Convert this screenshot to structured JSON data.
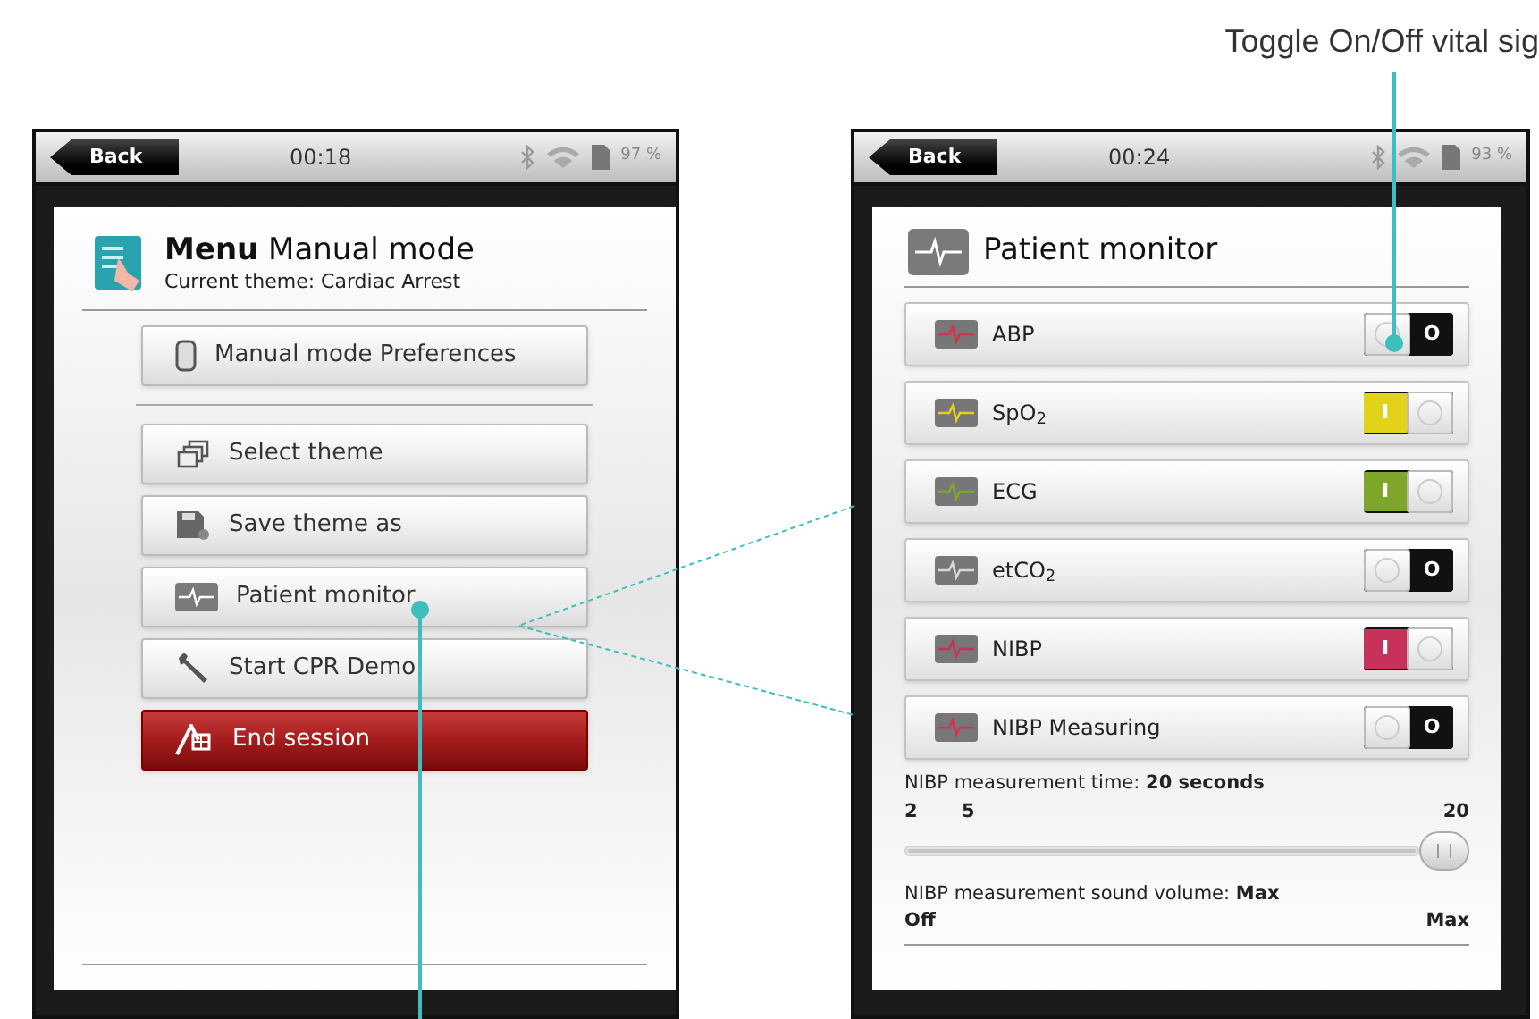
{
  "caption": "Toggle On/Off vital sig",
  "left_screen": {
    "status_bar": {
      "back": "Back",
      "time": "00:18",
      "battery": "97 %"
    },
    "dialog": {
      "title": "**Menu** Manual mode",
      "subtitle": "Current theme: Cardiac Arrest",
      "top_button": {
        "label": "Manual mode Preferences"
      },
      "buttons": [
        {
          "label": "Select theme",
          "kind": "normal"
        },
        {
          "label": "Save theme as",
          "kind": "normal"
        },
        {
          "label": "Patient monitor",
          "kind": "normal"
        },
        {
          "label": "Start CPR Demo",
          "kind": "normal"
        },
        {
          "label": "End session",
          "kind": "danger"
        }
      ]
    }
  },
  "right_screen": {
    "status_bar": {
      "back": "Back",
      "time": "00:24",
      "battery": "93 %"
    },
    "dialog": {
      "title": "Patient monitor",
      "vitals": [
        {
          "name": "ABP",
          "on": false,
          "switch_text": "O",
          "color": "#d9304f"
        },
        {
          "name": "SpO$_{2}$",
          "on": true,
          "switch_text": "I",
          "color": "#e2d21a"
        },
        {
          "name": "ECG",
          "on": true,
          "switch_text": "I",
          "color": "#7ea62a"
        },
        {
          "name": "etCO$_{2}$",
          "on": false,
          "switch_text": "O",
          "color": "#d8d8d8"
        },
        {
          "name": "NIBP",
          "on": true,
          "switch_text": "I",
          "color": "#c8325a"
        },
        {
          "name": "NIBP Measuring",
          "on": false,
          "switch_text": "O",
          "color": "#d9304f"
        }
      ],
      "time_setting": {
        "label": "NIBP measurement time: **20 seconds**",
        "ticks": [
          "2",
          "5",
          "20"
        ],
        "level": 1
      },
      "volume_setting": {
        "label": "NIBP measurement sound volume: **Max**",
        "min": "Off",
        "max": "Max"
      }
    }
  }
}
